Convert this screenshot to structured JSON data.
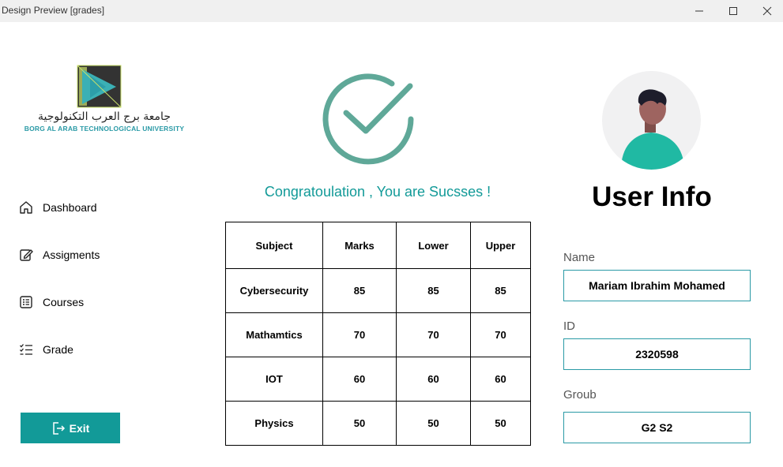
{
  "window": {
    "title": "Design Preview [grades]"
  },
  "logo": {
    "arabic": "جامعة برج العرب التكنولوجية",
    "english": "BORG AL ARAB TECHNOLOGICAL UNIVERSITY"
  },
  "sidebar": {
    "items": [
      {
        "label": "Dashboard",
        "icon": "home-icon"
      },
      {
        "label": "Assigments",
        "icon": "edit-icon"
      },
      {
        "label": "Courses",
        "icon": "list-icon"
      },
      {
        "label": "Grade",
        "icon": "checklist-icon"
      }
    ],
    "exit_label": "Exit"
  },
  "main": {
    "message": "Congratoulation , You are Sucsses !",
    "table": {
      "headers": [
        "Subject",
        "Marks",
        "Lower",
        "Upper"
      ],
      "rows": [
        [
          "Cybersecurity",
          "85",
          "85",
          "85"
        ],
        [
          "Mathamtics",
          "70",
          "70",
          "70"
        ],
        [
          "IOT",
          "60",
          "60",
          "60"
        ],
        [
          "Physics",
          "50",
          "50",
          "50"
        ]
      ]
    }
  },
  "user": {
    "heading": "User Info",
    "name_label": "Name",
    "name_value": "Mariam Ibrahim Mohamed",
    "id_label": "ID",
    "id_value": "2320598",
    "group_label": "Groub",
    "group_value": "G2 S2"
  },
  "colors": {
    "accent": "#129a98",
    "check": "#5fa898",
    "avatar_shirt": "#20b9a3"
  }
}
